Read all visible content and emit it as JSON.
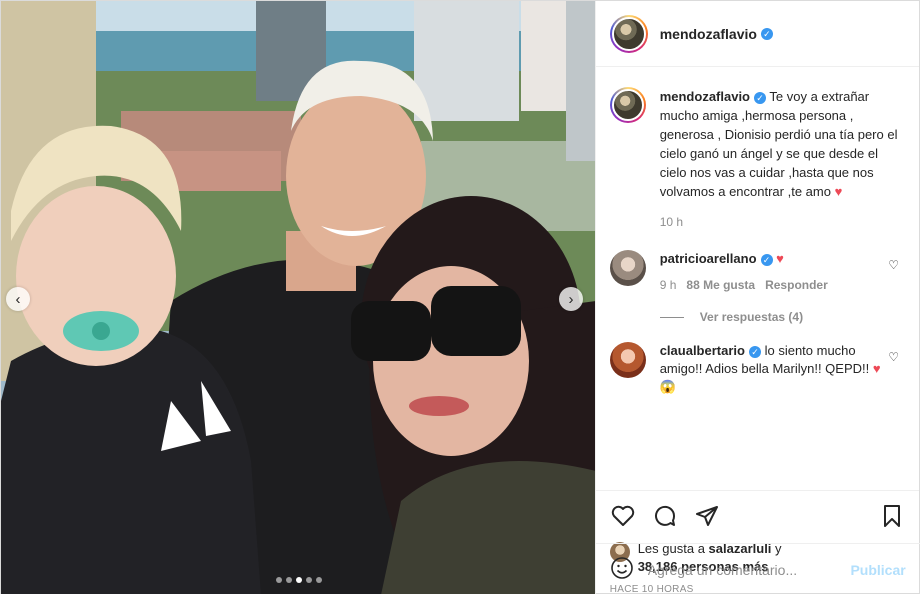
{
  "post": {
    "author": "mendozaflavio",
    "caption": "Te voy a extrañar mucho amiga ,hermosa persona , generosa , Dionisio perdió una tía pero el cielo ganó un ángel y se que desde el cielo nos vas a cuidar ,hasta que nos volvamos a encontrar ,te amo",
    "caption_emoji": "♥",
    "caption_age": "10 h",
    "carousel": {
      "total": 5,
      "active_index": 2
    }
  },
  "comments": [
    {
      "user": "patricioarellano",
      "text": "♥",
      "age": "9 h",
      "likes": "88 Me gusta",
      "reply_label": "Responder",
      "view_replies": "Ver respuestas (4)"
    },
    {
      "user": "claualbertario",
      "text": "lo siento mucho amigo!! Adios bella Marilyn!! QEPD!!",
      "emoji": "♥ 😱"
    }
  ],
  "likes": {
    "prefix": "Les gusta a",
    "user": "salazarluli",
    "joiner": "y",
    "count": "38,186 personas más"
  },
  "timestamp": "HACE 10 HORAS",
  "add_comment": {
    "placeholder": "Agrega un comentario...",
    "publish_label": "Publicar"
  },
  "icons": {
    "like": "heart-outline-icon",
    "comment": "speech-bubble-icon",
    "share": "paper-plane-icon",
    "save": "bookmark-icon",
    "emoji": "smiley-icon",
    "prev": "chevron-left-icon",
    "next": "chevron-right-icon"
  },
  "colors": {
    "verified": "#3897f0",
    "heart": "#ed4956",
    "publish_disabled": "#b2dffc"
  }
}
